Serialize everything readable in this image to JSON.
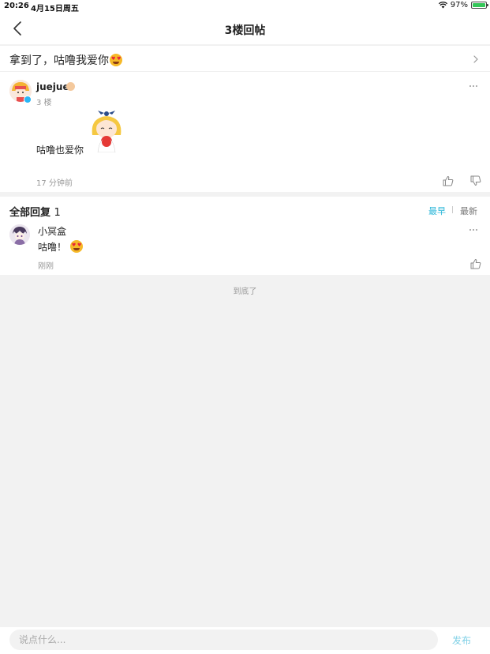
{
  "status_bar": {
    "time": "20:26",
    "date": "4月15日周五",
    "battery_text": "97%",
    "battery_level": 0.97,
    "icons": [
      "wifi-icon",
      "battery-icon"
    ]
  },
  "nav": {
    "title": "3楼回帖",
    "back_icon": "chevron-left-icon"
  },
  "post": {
    "title": "拿到了，咕噜我爱你",
    "title_emoji": "heart-eyes-emoji"
  },
  "main_reply": {
    "username": "juejue",
    "floor": "3 楼",
    "content": "咕噜也爱你",
    "time": "17 分钟前",
    "icons": [
      "more-icon",
      "thumbs-up-icon",
      "thumbs-down-icon",
      "verified-icon"
    ]
  },
  "replies": {
    "header": "全部回复",
    "count": "1",
    "sort_earliest": "最早",
    "sort_newest": "最新",
    "items": [
      {
        "username": "小冥盒",
        "content": "咕噜！",
        "time": "刚刚"
      }
    ]
  },
  "end_text": "到底了",
  "bottom_bar": {
    "placeholder": "说点什么...",
    "publish": "发布"
  },
  "colors": {
    "accent": "#29b6d8",
    "publish": "#7fd0e6",
    "background": "#f2f2f2",
    "muted": "#999999"
  }
}
